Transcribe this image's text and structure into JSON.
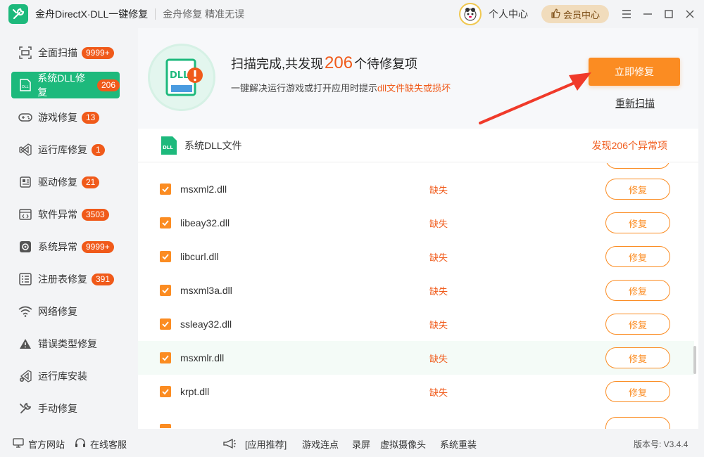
{
  "titlebar": {
    "app_title": "金舟DirectX·DLL一键修复",
    "slogan": "金舟修复 精准无误",
    "user_label": "个人中心",
    "vip_label": "会员中心"
  },
  "sidebar": {
    "items": [
      {
        "label": "全面扫描",
        "badge": "9999+",
        "icon": "scan-icon"
      },
      {
        "label": "系统DLL修复",
        "badge": "206",
        "icon": "dll-icon",
        "active": true
      },
      {
        "label": "游戏修复",
        "badge": "13",
        "icon": "gamepad-icon"
      },
      {
        "label": "运行库修复",
        "badge": "1",
        "icon": "runtime-icon"
      },
      {
        "label": "驱动修复",
        "badge": "21",
        "icon": "driver-icon"
      },
      {
        "label": "软件异常",
        "badge": "3503",
        "icon": "code-window-icon"
      },
      {
        "label": "系统异常",
        "badge": "9999+",
        "icon": "gear-icon"
      },
      {
        "label": "注册表修复",
        "badge": "391",
        "icon": "registry-icon"
      },
      {
        "label": "网络修复",
        "badge": "",
        "icon": "wifi-icon"
      },
      {
        "label": "错误类型修复",
        "badge": "",
        "icon": "warning-icon"
      },
      {
        "label": "运行库安装",
        "badge": "",
        "icon": "install-icon"
      },
      {
        "label": "手动修复",
        "badge": "",
        "icon": "wrench-icon"
      }
    ]
  },
  "summary": {
    "title_prefix": "扫描完成,共发现",
    "count": "206",
    "title_suffix": "个待修复项",
    "desc_prefix": "一键解决运行游戏或打开应用时提示",
    "desc_highlight": "dll文件缺失或损坏",
    "illust_text": "DLL",
    "fix_now": "立即修复",
    "rescan": "重新扫描"
  },
  "list": {
    "title": "系统DLL文件",
    "found": "发现206个异常项",
    "rows": [
      {
        "name": "msxml2.dll",
        "status": "缺失",
        "action": "修复"
      },
      {
        "name": "libeay32.dll",
        "status": "缺失",
        "action": "修复"
      },
      {
        "name": "libcurl.dll",
        "status": "缺失",
        "action": "修复"
      },
      {
        "name": "msxml3a.dll",
        "status": "缺失",
        "action": "修复"
      },
      {
        "name": "ssleay32.dll",
        "status": "缺失",
        "action": "修复"
      },
      {
        "name": "msxmlr.dll",
        "status": "缺失",
        "action": "修复"
      },
      {
        "name": "krpt.dll",
        "status": "缺失",
        "action": "修复"
      }
    ]
  },
  "footer": {
    "official_site": "官方网站",
    "online_service": "在线客服",
    "app_recommend": "[应用推荐]",
    "links": [
      "游戏连点",
      "录屏",
      "虚拟摄像头",
      "系统重装"
    ],
    "version": "版本号: V3.4.4"
  },
  "colors": {
    "brand_green": "#1db97c",
    "accent_orange": "#fb8c22",
    "alert_red": "#f05a1a"
  }
}
